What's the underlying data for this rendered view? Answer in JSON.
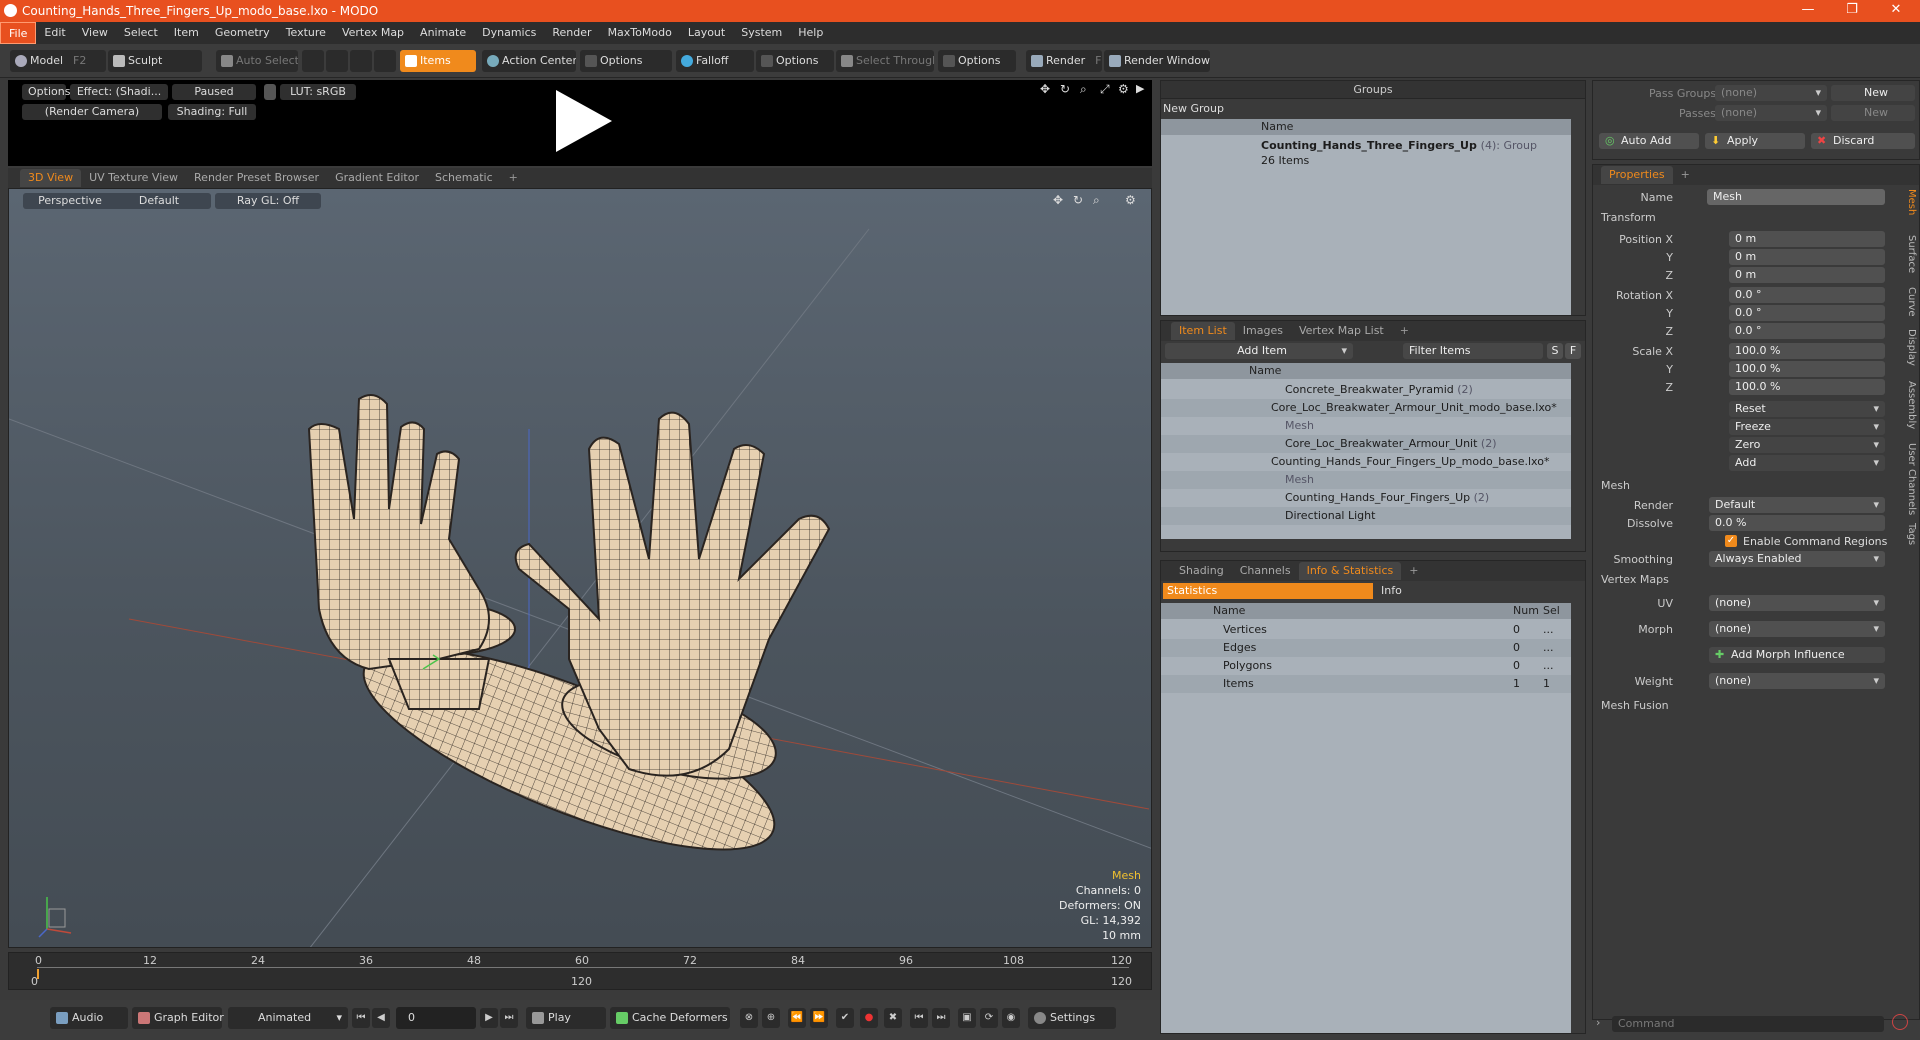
{
  "window": {
    "title": "Counting_Hands_Three_Fingers_Up_modo_base.lxo - MODO"
  },
  "menu": [
    "File",
    "Edit",
    "View",
    "Select",
    "Item",
    "Geometry",
    "Texture",
    "Vertex Map",
    "Animate",
    "Dynamics",
    "Render",
    "MaxToModo",
    "Layout",
    "System",
    "Help"
  ],
  "toolbar": {
    "model": "Model",
    "model_key": "F2",
    "sculpt": "Sculpt",
    "auto_select": "Auto Select",
    "items": "Items",
    "action_center": "Action Center",
    "options1": "Options",
    "falloff": "Falloff",
    "options2": "Options",
    "select_through": "Select Through",
    "options3": "Options",
    "render": "Render",
    "render_key": "F9",
    "render_window": "Render Window"
  },
  "preview": {
    "options": "Options",
    "effect": "Effect: (Shadi...",
    "paused": "Paused",
    "lut": "LUT: sRGB",
    "camera": "(Render Camera)",
    "shading": "Shading: Full"
  },
  "viewtabs": [
    "3D View",
    "UV Texture View",
    "Render Preset Browser",
    "Gradient Editor",
    "Schematic",
    "+"
  ],
  "viewport": {
    "perspective": "Perspective",
    "default": "Default",
    "raygl": "Ray GL: Off",
    "stats": {
      "type": "Mesh",
      "channels": "Channels: 0",
      "deformers": "Deformers: ON",
      "gl": "GL: 14,392",
      "unit": "10 mm"
    }
  },
  "timeline": {
    "ticks": [
      "0",
      "12",
      "24",
      "36",
      "48",
      "60",
      "72",
      "84",
      "96",
      "108",
      "120"
    ],
    "start": "0",
    "mid": "120",
    "end": "120"
  },
  "bottom": {
    "audio": "Audio",
    "graph_editor": "Graph Editor",
    "animated": "Animated",
    "frame": "0",
    "play": "Play",
    "cache": "Cache Deformers",
    "settings": "Settings"
  },
  "groups": {
    "title": "Groups",
    "new_group": "New Group",
    "col_name": "Name",
    "item": "Counting_Hands_Three_Fingers_Up",
    "item_count": "(4)",
    "item_type": ": Group",
    "sub": "26 Items"
  },
  "itemlist": {
    "tabs": [
      "Item List",
      "Images",
      "Vertex Map List",
      "+"
    ],
    "add_item": "Add Item",
    "filter": "Filter Items",
    "s": "S",
    "f": "F",
    "col_name": "Name",
    "rows": [
      {
        "label": "Concrete_Breakwater_Pyramid",
        "count": "(2)"
      },
      {
        "label": "Core_Loc_Breakwater_Armour_Unit_modo_base.lxo*",
        "count": ""
      },
      {
        "label": "Mesh",
        "count": ""
      },
      {
        "label": "Core_Loc_Breakwater_Armour_Unit",
        "count": "(2)"
      },
      {
        "label": "Counting_Hands_Four_Fingers_Up_modo_base.lxo*",
        "count": ""
      },
      {
        "label": "Mesh",
        "count": ""
      },
      {
        "label": "Counting_Hands_Four_Fingers_Up",
        "count": "(2)"
      },
      {
        "label": "Directional Light",
        "count": ""
      }
    ]
  },
  "info": {
    "tabs": [
      "Shading",
      "Channels",
      "Info & Statistics",
      "+"
    ],
    "statistics": "Statistics",
    "info": "Info",
    "col_name": "Name",
    "col_num": "Num",
    "col_sel": "Sel",
    "rows": [
      {
        "name": "Vertices",
        "num": "0",
        "sel": "..."
      },
      {
        "name": "Edges",
        "num": "0",
        "sel": "..."
      },
      {
        "name": "Polygons",
        "num": "0",
        "sel": "..."
      },
      {
        "name": "Items",
        "num": "1",
        "sel": "1"
      }
    ]
  },
  "passes": {
    "pass_groups": "Pass Groups",
    "passes": "Passes",
    "none1": "(none)",
    "none2": "(none)",
    "new1": "New",
    "new2": "New",
    "auto_add": "Auto Add",
    "apply": "Apply",
    "discard": "Discard"
  },
  "properties": {
    "tab": "Properties",
    "plus": "+",
    "name_label": "Name",
    "name_value": "Mesh",
    "transform": "Transform",
    "position_label": "Position X",
    "pos": [
      "0 m",
      "0 m",
      "0 m"
    ],
    "rotation_label": "Rotation X",
    "rot": [
      "0.0 °",
      "0.0 °",
      "0.0 °"
    ],
    "scale_label": "Scale X",
    "scl": [
      "100.0 %",
      "100.0 %",
      "100.0 %"
    ],
    "y": "Y",
    "z": "Z",
    "reset": "Reset",
    "freeze": "Freeze",
    "zero": "Zero",
    "add": "Add",
    "mesh": "Mesh",
    "render_label": "Render",
    "render_value": "Default",
    "dissolve_label": "Dissolve",
    "dissolve_value": "0.0 %",
    "enable_cmd": "Enable Command Regions",
    "smoothing_label": "Smoothing",
    "smoothing_value": "Always Enabled",
    "vertex_maps": "Vertex Maps",
    "uv_label": "UV",
    "uv_value": "(none)",
    "morph_label": "Morph",
    "morph_value": "(none)",
    "add_morph": "Add Morph Influence",
    "weight_label": "Weight",
    "weight_value": "(none)",
    "mesh_fusion": "Mesh Fusion",
    "vtabs": [
      "Mesh",
      "Surface",
      "Curve",
      "Display",
      "Assembly",
      "User Channels",
      "Tags"
    ],
    "command": "Command"
  },
  "colors": {
    "accent": "#f08a1c",
    "title": "#e8501f"
  }
}
